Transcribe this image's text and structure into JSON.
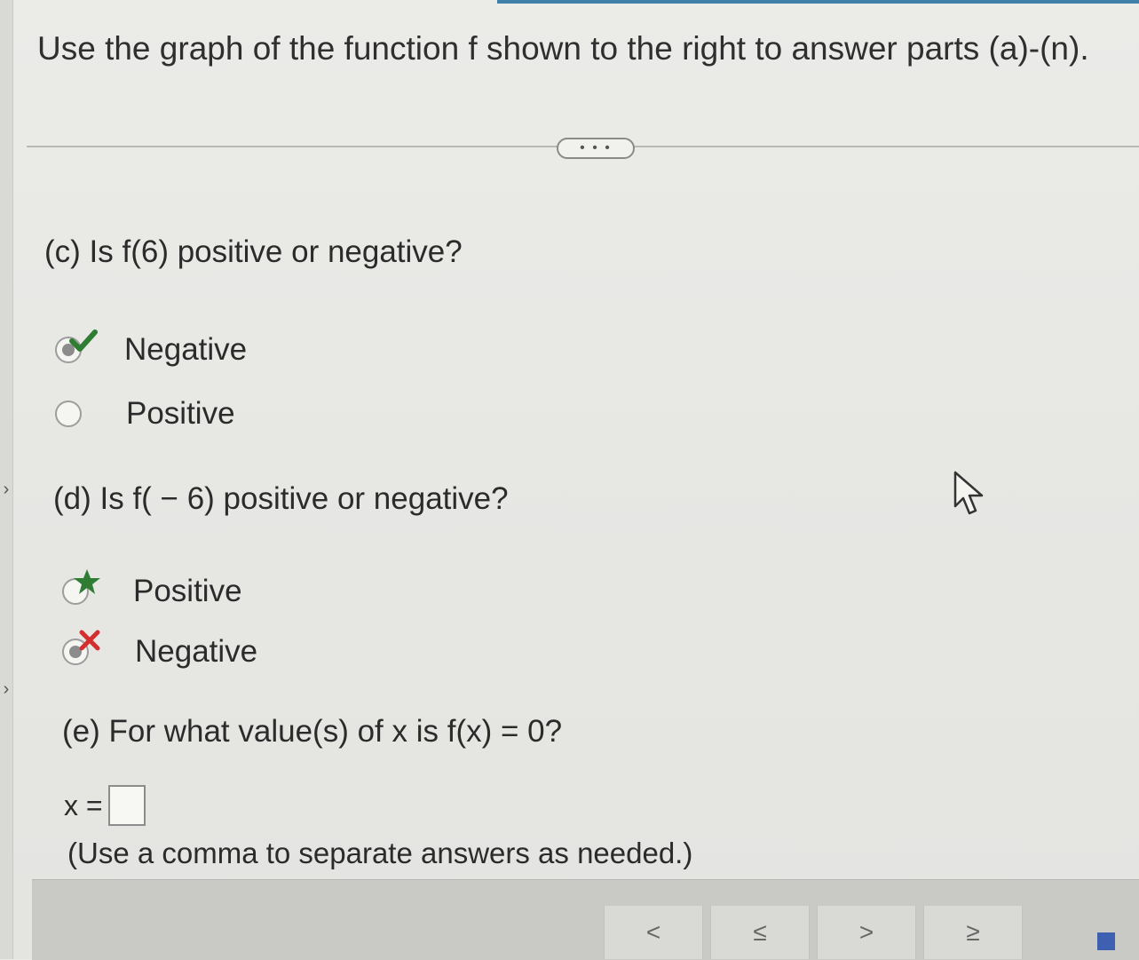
{
  "header": {
    "title": "Use the graph of the function f shown to the right to answer parts (a)-(n).",
    "more_label": "• • •"
  },
  "questions": {
    "c": {
      "prompt": "(c) Is f(6) positive or negative?",
      "options": [
        {
          "label": "Negative",
          "selected": true,
          "mark": "check-icon"
        },
        {
          "label": "Positive",
          "selected": false
        }
      ]
    },
    "d": {
      "prompt": "(d) Is f( − 6) positive or negative?",
      "options": [
        {
          "label": "Positive",
          "selected": false,
          "mark": "star-icon"
        },
        {
          "label": "Negative",
          "selected": true,
          "mark": "x-mark-icon"
        }
      ]
    },
    "e": {
      "prompt": "(e) For what value(s) of x is f(x) = 0?",
      "answer_prefix": "x =",
      "answer_value": "",
      "hint": "(Use a comma to separate answers as needed.)"
    }
  },
  "toolbar": {
    "btn1": "<",
    "btn2": "≤",
    "btn3": ">",
    "btn4": "≥"
  },
  "colors": {
    "correct": "#2e7d32",
    "incorrect": "#d32f2f",
    "accent": "#3f7fa8"
  }
}
